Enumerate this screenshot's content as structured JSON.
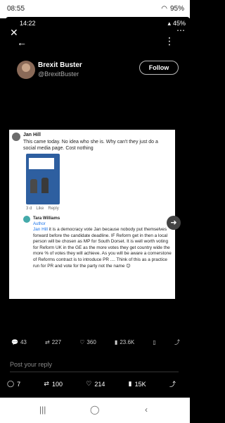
{
  "outer_status": {
    "time": "08:55",
    "battery": "95%"
  },
  "inner_status": {
    "time": "14:22",
    "battery": "45%"
  },
  "profile": {
    "name": "Brexit Buster",
    "handle": "@BrexitBuster",
    "follow_label": "Follow"
  },
  "post": {
    "comment1": {
      "author": "Jan Hill",
      "text": "This came today. No idea who she is. Why can't they just do a social media page. Cost nothing",
      "time": "3 d",
      "like": "Like",
      "reply": "Reply"
    },
    "comment2": {
      "author": "Tara Williams",
      "role": "Author",
      "mention": "Jan Hill",
      "text": " it is a democracy vote Jan because nobody put themselves forward before the candidate deadline. IF Reform get in then a local person will be chosen as MP for South Dorset. It is well worth voting for Reform UK in the GE as the more votes they get country wide the more % of votes they will achieve. As you will be aware a cornerstone of Reforms contract is to introduce PR .... Think of this as a practice run for PR and vote for the party not the name 😉"
    }
  },
  "stats": {
    "replies": "43",
    "reposts": "227",
    "likes": "360",
    "views": "23.6K"
  },
  "reply_placeholder": "Post your reply",
  "bottom": {
    "replies": "7",
    "reposts": "100",
    "likes": "214",
    "views": "15K"
  }
}
